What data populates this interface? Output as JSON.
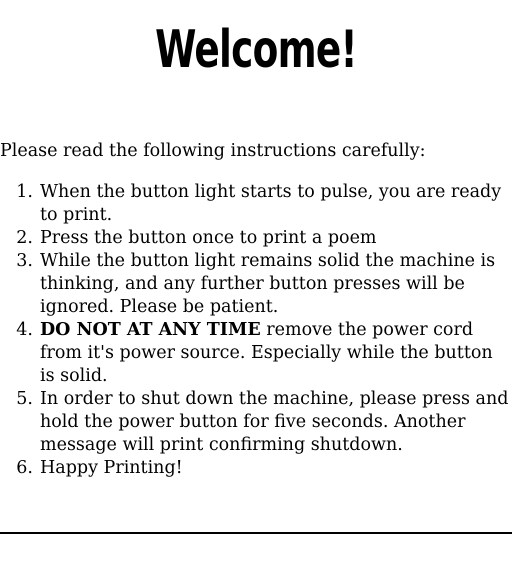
{
  "title": "Welcome!",
  "intro": "Please read the following instructions carefully:",
  "steps": [
    {
      "num": "1.",
      "text": "When the button light starts to pulse, you are ready to print."
    },
    {
      "num": "2.",
      "text": "Press the button once to print a poem"
    },
    {
      "num": "3.",
      "text": "While the button light remains solid the machine is thinking, and any further button presses will be ignored. Please be patient."
    },
    {
      "num": "4.",
      "bold": "DO NOT AT ANY TIME",
      "text": " remove the power cord from it's power source. Especially while the button is solid."
    },
    {
      "num": "5.",
      "text": "In order to shut down the machine, please press and hold the power button for five seconds. Another message will print confirming shutdown."
    },
    {
      "num": "6.",
      "text": "Happy Printing!"
    }
  ]
}
